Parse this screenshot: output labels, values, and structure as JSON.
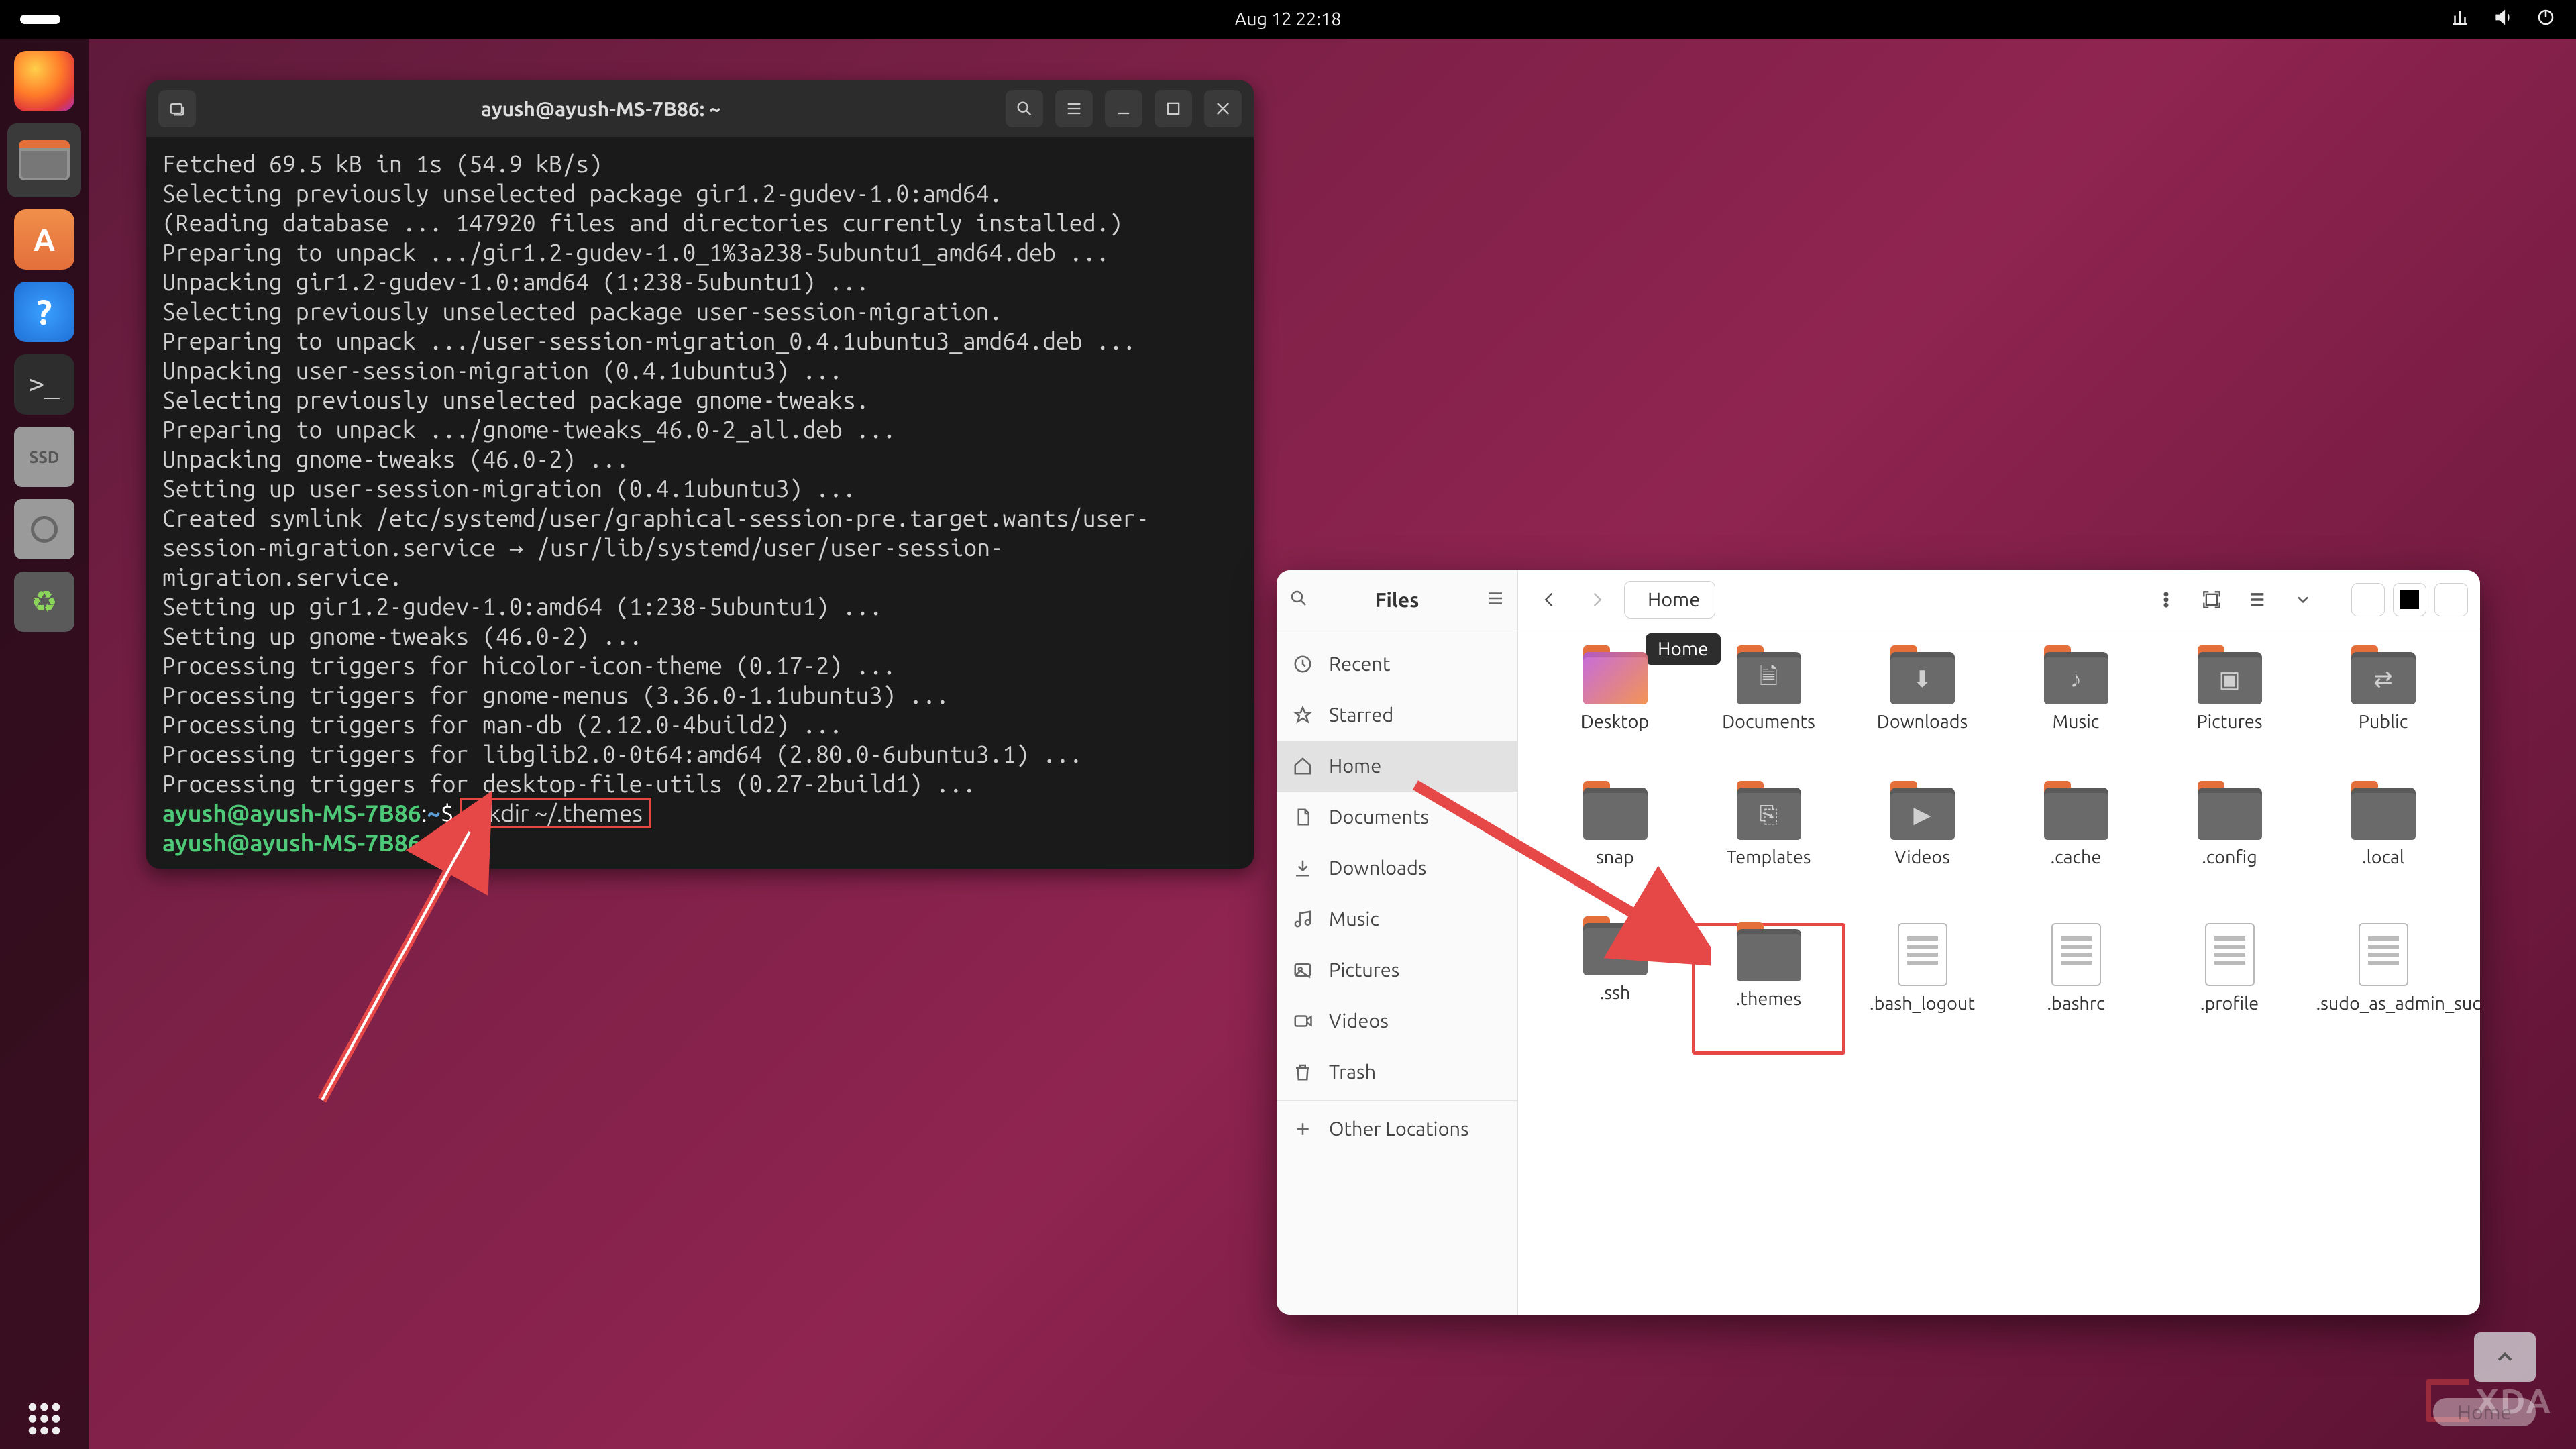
{
  "topbar": {
    "clock": "Aug 12  22:18"
  },
  "dock": {
    "items": [
      "firefox",
      "files",
      "software",
      "help",
      "terminal",
      "disks-ssd",
      "disks",
      "trash"
    ],
    "show_apps": "show-applications"
  },
  "terminal": {
    "title": "ayush@ayush-MS-7B86: ~",
    "output_lines": [
      "Fetched 69.5 kB in 1s (54.9 kB/s)",
      "Selecting previously unselected package gir1.2-gudev-1.0:amd64.",
      "(Reading database ... 147920 files and directories currently installed.)",
      "Preparing to unpack .../gir1.2-gudev-1.0_1%3a238-5ubuntu1_amd64.deb ...",
      "Unpacking gir1.2-gudev-1.0:amd64 (1:238-5ubuntu1) ...",
      "Selecting previously unselected package user-session-migration.",
      "Preparing to unpack .../user-session-migration_0.4.1ubuntu3_amd64.deb ...",
      "Unpacking user-session-migration (0.4.1ubuntu3) ...",
      "Selecting previously unselected package gnome-tweaks.",
      "Preparing to unpack .../gnome-tweaks_46.0-2_all.deb ...",
      "Unpacking gnome-tweaks (46.0-2) ...",
      "Setting up user-session-migration (0.4.1ubuntu3) ...",
      "Created symlink /etc/systemd/user/graphical-session-pre.target.wants/user-session-migration.service → /usr/lib/systemd/user/user-session-migration.service.",
      "Setting up gir1.2-gudev-1.0:amd64 (1:238-5ubuntu1) ...",
      "Setting up gnome-tweaks (46.0-2) ...",
      "Processing triggers for hicolor-icon-theme (0.17-2) ...",
      "Processing triggers for gnome-menus (3.36.0-1.1ubuntu3) ...",
      "Processing triggers for man-db (2.12.0-4build2) ...",
      "Processing triggers for libglib2.0-0t64:amd64 (2.80.0-6ubuntu3.1) ...",
      "Processing triggers for desktop-file-utils (0.27-2build1) ..."
    ],
    "prompt_user": "ayush@ayush-MS-7B86",
    "prompt_path": "~",
    "command": "mkdir ~/.themes"
  },
  "files": {
    "app_label": "Files",
    "path_home": "Home",
    "tooltip_home": "Home",
    "sidebar": [
      {
        "icon": "clock",
        "label": "Recent"
      },
      {
        "icon": "star",
        "label": "Starred"
      },
      {
        "icon": "home",
        "label": "Home",
        "active": true
      },
      {
        "icon": "doc",
        "label": "Documents"
      },
      {
        "icon": "download",
        "label": "Downloads"
      },
      {
        "icon": "music",
        "label": "Music"
      },
      {
        "icon": "picture",
        "label": "Pictures"
      },
      {
        "icon": "video",
        "label": "Videos"
      },
      {
        "icon": "trash",
        "label": "Trash"
      }
    ],
    "other_locations": "Other Locations",
    "grid": [
      {
        "name": "Desktop",
        "type": "folder-bright"
      },
      {
        "name": "Documents",
        "type": "folder",
        "emblem": "doc"
      },
      {
        "name": "Downloads",
        "type": "folder",
        "emblem": "download"
      },
      {
        "name": "Music",
        "type": "folder",
        "emblem": "music"
      },
      {
        "name": "Pictures",
        "type": "folder",
        "emblem": "picture"
      },
      {
        "name": "Public",
        "type": "folder",
        "emblem": "share"
      },
      {
        "name": "snap",
        "type": "folder"
      },
      {
        "name": "Templates",
        "type": "folder",
        "emblem": "templates"
      },
      {
        "name": "Videos",
        "type": "folder",
        "emblem": "video"
      },
      {
        "name": ".cache",
        "type": "folder"
      },
      {
        "name": ".config",
        "type": "folder"
      },
      {
        "name": ".local",
        "type": "folder"
      },
      {
        "name": ".ssh",
        "type": "folder"
      },
      {
        "name": ".themes",
        "type": "folder",
        "highlight": true
      },
      {
        "name": ".bash_logout",
        "type": "file"
      },
      {
        "name": ".bashrc",
        "type": "file"
      },
      {
        "name": ".profile",
        "type": "file"
      },
      {
        "name": ".sudo_as_admin_successful",
        "type": "file"
      }
    ]
  },
  "watermark": "XDA",
  "breadcrumb_bottom": "Home"
}
